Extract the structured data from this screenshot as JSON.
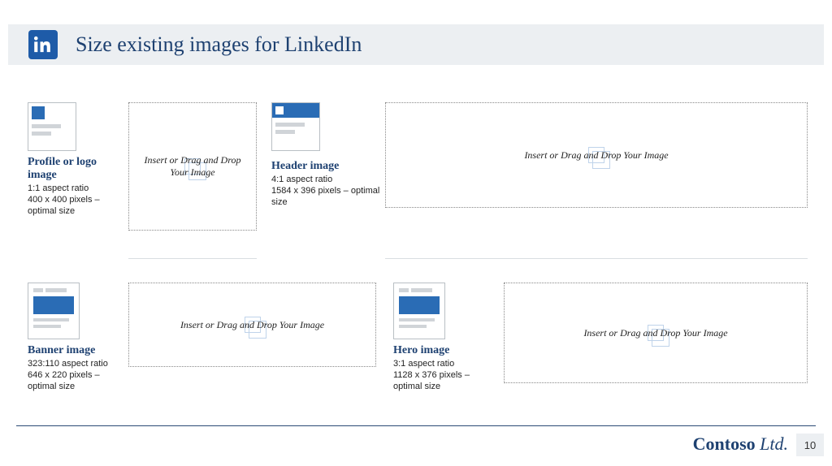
{
  "title": "Size existing images for LinkedIn",
  "cards": {
    "profile": {
      "title": "Profile or logo image",
      "desc": "1:1 aspect ratio\n400 x 400 pixels – optimal size"
    },
    "header": {
      "title": "Header image",
      "desc": "4:1 aspect ratio\n1584 x 396 pixels – optimal size"
    },
    "banner": {
      "title": "Banner image",
      "desc": "323:110 aspect ratio\n646 x 220 pixels – optimal size"
    },
    "hero": {
      "title": "Hero image",
      "desc": "3:1 aspect ratio\n1128 x 376 pixels – optimal size"
    }
  },
  "dropzone_text": "Insert or Drag and Drop Your Image",
  "footer": {
    "brand_bold": "Contoso",
    "brand_ital": " Ltd.",
    "page": "10"
  }
}
